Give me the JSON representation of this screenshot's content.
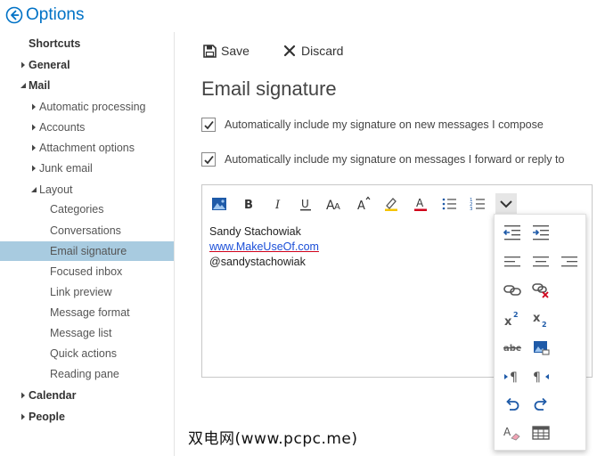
{
  "app": {
    "title": "Options"
  },
  "colors": {
    "accent": "#0072c6",
    "selected_bg": "#a8cbe0",
    "font_red": "#d0021b",
    "highlight_yellow": "#f5c400"
  },
  "sidebar": {
    "items": [
      {
        "label": "Shortcuts",
        "level": 0,
        "caret": "none"
      },
      {
        "label": "General",
        "level": 0,
        "caret": "right"
      },
      {
        "label": "Mail",
        "level": 0,
        "caret": "down"
      },
      {
        "label": "Automatic processing",
        "level": 1,
        "caret": "right"
      },
      {
        "label": "Accounts",
        "level": 1,
        "caret": "right"
      },
      {
        "label": "Attachment options",
        "level": 1,
        "caret": "right"
      },
      {
        "label": "Junk email",
        "level": 1,
        "caret": "right"
      },
      {
        "label": "Layout",
        "level": 1,
        "caret": "down"
      },
      {
        "label": "Categories",
        "level": 2,
        "caret": "none"
      },
      {
        "label": "Conversations",
        "level": 2,
        "caret": "none"
      },
      {
        "label": "Email signature",
        "level": 2,
        "caret": "none",
        "selected": true
      },
      {
        "label": "Focused inbox",
        "level": 2,
        "caret": "none"
      },
      {
        "label": "Link preview",
        "level": 2,
        "caret": "none"
      },
      {
        "label": "Message format",
        "level": 2,
        "caret": "none"
      },
      {
        "label": "Message list",
        "level": 2,
        "caret": "none"
      },
      {
        "label": "Quick actions",
        "level": 2,
        "caret": "none"
      },
      {
        "label": "Reading pane",
        "level": 2,
        "caret": "none"
      },
      {
        "label": "Calendar",
        "level": 0,
        "caret": "right"
      },
      {
        "label": "People",
        "level": 0,
        "caret": "right"
      }
    ]
  },
  "toolbar": {
    "save_label": "Save",
    "discard_label": "Discard"
  },
  "main": {
    "title": "Email signature",
    "options": [
      {
        "label": "Automatically include my signature on new messages I compose",
        "checked": true
      },
      {
        "label": "Automatically include my signature on messages I forward or reply to",
        "checked": true
      }
    ]
  },
  "editor": {
    "format_buttons": [
      "insert-picture-icon",
      "bold-icon",
      "italic-icon",
      "underline-icon",
      "font-size-icon",
      "grow-font-icon",
      "highlight-icon",
      "font-color-icon",
      "bullets-icon",
      "numbering-icon",
      "more-options-icon"
    ],
    "signature": {
      "line1": "Sandy Stachowiak",
      "line2": "www.MakeUseOf.com",
      "line3": "@sandystachowiak"
    },
    "more_menu": [
      "decrease-indent-icon",
      "increase-indent-icon",
      "align-left-icon",
      "align-center-icon",
      "align-right-icon",
      "insert-link-icon",
      "remove-link-icon",
      "superscript-icon",
      "subscript-icon",
      "strikethrough-icon",
      "insert-image-icon",
      "ltr-icon",
      "rtl-icon",
      "undo-icon",
      "redo-icon",
      "clear-formatting-icon",
      "insert-table-icon"
    ]
  },
  "watermark": {
    "text": "双电网(www.pcpc.me)"
  }
}
